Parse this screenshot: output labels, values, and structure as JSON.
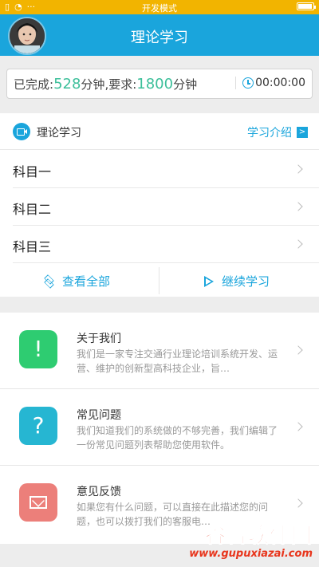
{
  "statusbar": {
    "mode": "开发模式"
  },
  "header": {
    "title": "理论学习"
  },
  "progress": {
    "completed_label": "已完成:",
    "completed_value": "528",
    "minutes_unit": "分钟",
    "required_label": ",要求:",
    "required_value": "1800",
    "timer": "00:00:00"
  },
  "study": {
    "section_label": "理论学习",
    "intro_label": "学习介绍",
    "subjects": [
      "科目一",
      "科目二",
      "科目三"
    ],
    "view_all_label": "查看全部",
    "continue_label": "继续学习"
  },
  "info": [
    {
      "title": "关于我们",
      "desc": "我们是一家专注交通行业理论培训系统开发、运营、维护的创新型高科技企业，旨…",
      "color": "#2ecc71",
      "icon": "!"
    },
    {
      "title": "常见问题",
      "desc": "我们知道我们的系统做的不够完善，我们编辑了一份常见问题列表帮助您使用软件。",
      "color": "#26b6d2",
      "icon": "?"
    },
    {
      "title": "意见反馈",
      "desc": "如果您有什么问题，可以直接在此描述您的问题，也可以拨打我们的客服电…",
      "color": "#ec7f7a",
      "icon": "mail-icon"
    }
  ],
  "watermark": {
    "main": "谷普软件园",
    "url": "www.gupuxiazai.com"
  }
}
